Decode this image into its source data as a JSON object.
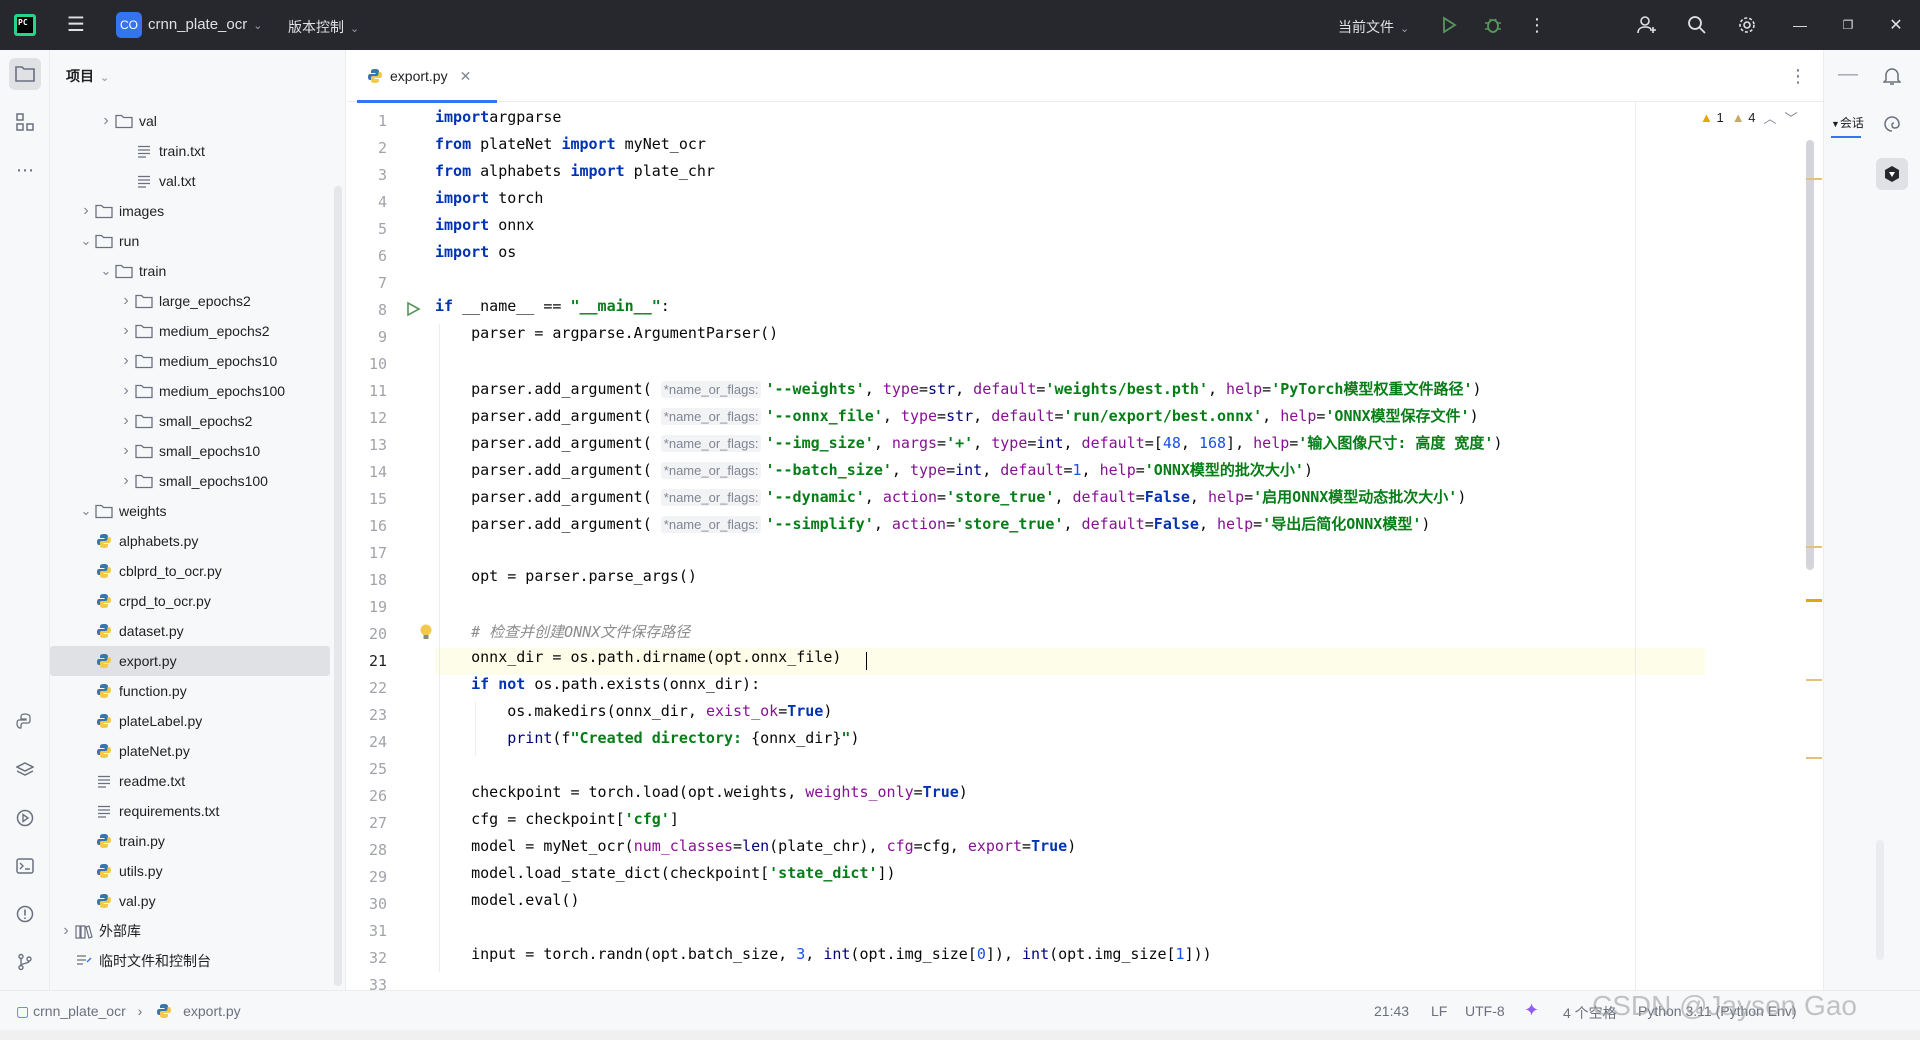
{
  "titlebar": {
    "project_badge": "CO",
    "project_name": "crnn_plate_ocr",
    "vcs_label": "版本控制",
    "run_config": "当前文件"
  },
  "project_panel": {
    "title": "项目",
    "items": [
      {
        "label": "val",
        "type": "folder",
        "depth": 2,
        "state": "collapsed"
      },
      {
        "label": "train.txt",
        "type": "text",
        "depth": 3
      },
      {
        "label": "val.txt",
        "type": "text",
        "depth": 3
      },
      {
        "label": "images",
        "type": "folder",
        "depth": 1,
        "state": "collapsed"
      },
      {
        "label": "run",
        "type": "folder",
        "depth": 1,
        "state": "expanded"
      },
      {
        "label": "train",
        "type": "folder",
        "depth": 2,
        "state": "expanded"
      },
      {
        "label": "large_epochs2",
        "type": "folder",
        "depth": 3,
        "state": "collapsed"
      },
      {
        "label": "medium_epochs2",
        "type": "folder",
        "depth": 3,
        "state": "collapsed"
      },
      {
        "label": "medium_epochs10",
        "type": "folder",
        "depth": 3,
        "state": "collapsed"
      },
      {
        "label": "medium_epochs100",
        "type": "folder",
        "depth": 3,
        "state": "collapsed"
      },
      {
        "label": "small_epochs2",
        "type": "folder",
        "depth": 3,
        "state": "collapsed"
      },
      {
        "label": "small_epochs10",
        "type": "folder",
        "depth": 3,
        "state": "collapsed"
      },
      {
        "label": "small_epochs100",
        "type": "folder",
        "depth": 3,
        "state": "collapsed"
      },
      {
        "label": "weights",
        "type": "folder",
        "depth": 1,
        "state": "expanded"
      },
      {
        "label": "alphabets.py",
        "type": "python",
        "depth": 1
      },
      {
        "label": "cblprd_to_ocr.py",
        "type": "python",
        "depth": 1
      },
      {
        "label": "crpd_to_ocr.py",
        "type": "python",
        "depth": 1
      },
      {
        "label": "dataset.py",
        "type": "python",
        "depth": 1
      },
      {
        "label": "export.py",
        "type": "python",
        "depth": 1,
        "selected": true
      },
      {
        "label": "function.py",
        "type": "python",
        "depth": 1
      },
      {
        "label": "plateLabel.py",
        "type": "python",
        "depth": 1
      },
      {
        "label": "plateNet.py",
        "type": "python",
        "depth": 1
      },
      {
        "label": "readme.txt",
        "type": "text",
        "depth": 1
      },
      {
        "label": "requirements.txt",
        "type": "text",
        "depth": 1
      },
      {
        "label": "train.py",
        "type": "python",
        "depth": 1
      },
      {
        "label": "utils.py",
        "type": "python",
        "depth": 1
      },
      {
        "label": "val.py",
        "type": "python",
        "depth": 1
      },
      {
        "label": "外部库",
        "type": "library",
        "depth": 0,
        "state": "collapsed"
      },
      {
        "label": "临时文件和控制台",
        "type": "scratch",
        "depth": 0
      }
    ]
  },
  "editor": {
    "tab_label": "export.py",
    "inspections": {
      "errors": "1",
      "warnings": "4"
    },
    "caret_line": 21,
    "lines": [
      [
        [
          "kw",
          "import"
        ],
        [
          "",
          "argparse"
        ]
      ],
      [
        [
          "kw",
          "from"
        ],
        [
          "",
          " plateNet "
        ],
        [
          "kw",
          "import"
        ],
        [
          "",
          " myNet_ocr"
        ]
      ],
      [
        [
          "kw",
          "from"
        ],
        [
          "",
          " alphabets "
        ],
        [
          "kw",
          "import"
        ],
        [
          "",
          " plate_chr"
        ]
      ],
      [
        [
          "kw",
          "import"
        ],
        [
          "",
          " torch"
        ]
      ],
      [
        [
          "kw",
          "import"
        ],
        [
          "",
          " onnx"
        ]
      ],
      [
        [
          "kw",
          "import"
        ],
        [
          "",
          " os"
        ]
      ],
      [],
      [
        [
          "kw",
          "if"
        ],
        [
          "",
          " __name__ == "
        ],
        [
          "st",
          "\"__main__\""
        ],
        [
          "",
          ":"
        ]
      ],
      [
        [
          "",
          "    parser = argparse.ArgumentParser()"
        ]
      ],
      [],
      [
        [
          "",
          "    parser.add_argument( "
        ],
        [
          "hint",
          "*name_or_flags:"
        ],
        [
          "st",
          "'--weights'"
        ],
        [
          "",
          ", "
        ],
        [
          "pr",
          "type"
        ],
        [
          "",
          "="
        ],
        [
          "bi",
          "str"
        ],
        [
          "",
          ", "
        ],
        [
          "pr",
          "default"
        ],
        [
          "",
          "="
        ],
        [
          "st",
          "'weights/best.pth'"
        ],
        [
          "",
          ", "
        ],
        [
          "pr",
          "help"
        ],
        [
          "",
          "="
        ],
        [
          "st",
          "'PyTorch模型权重文件路径'"
        ],
        [
          "",
          ")"
        ]
      ],
      [
        [
          "",
          "    parser.add_argument( "
        ],
        [
          "hint",
          "*name_or_flags:"
        ],
        [
          "st",
          "'--onnx_file'"
        ],
        [
          "",
          ", "
        ],
        [
          "pr",
          "type"
        ],
        [
          "",
          "="
        ],
        [
          "bi",
          "str"
        ],
        [
          "",
          ", "
        ],
        [
          "pr",
          "default"
        ],
        [
          "",
          "="
        ],
        [
          "st",
          "'run/export/best.onnx'"
        ],
        [
          "",
          ", "
        ],
        [
          "pr",
          "help"
        ],
        [
          "",
          "="
        ],
        [
          "st",
          "'ONNX模型保存文件'"
        ],
        [
          "",
          ")"
        ]
      ],
      [
        [
          "",
          "    parser.add_argument( "
        ],
        [
          "hint",
          "*name_or_flags:"
        ],
        [
          "st",
          "'--img_size'"
        ],
        [
          "",
          ", "
        ],
        [
          "pr",
          "nargs"
        ],
        [
          "",
          "="
        ],
        [
          "st",
          "'+'"
        ],
        [
          "",
          ", "
        ],
        [
          "pr",
          "type"
        ],
        [
          "",
          "="
        ],
        [
          "bi",
          "int"
        ],
        [
          "",
          ", "
        ],
        [
          "pr",
          "default"
        ],
        [
          "",
          "=["
        ],
        [
          "nu",
          "48"
        ],
        [
          "",
          ", "
        ],
        [
          "nu",
          "168"
        ],
        [
          "",
          "], "
        ],
        [
          "pr",
          "help"
        ],
        [
          "",
          "="
        ],
        [
          "st",
          "'输入图像尺寸: 高度 宽度'"
        ],
        [
          "",
          ")"
        ]
      ],
      [
        [
          "",
          "    parser.add_argument( "
        ],
        [
          "hint",
          "*name_or_flags:"
        ],
        [
          "st",
          "'--batch_size'"
        ],
        [
          "",
          ", "
        ],
        [
          "pr",
          "type"
        ],
        [
          "",
          "="
        ],
        [
          "bi",
          "int"
        ],
        [
          "",
          ", "
        ],
        [
          "pr",
          "default"
        ],
        [
          "",
          "="
        ],
        [
          "nu",
          "1"
        ],
        [
          "",
          ", "
        ],
        [
          "pr",
          "help"
        ],
        [
          "",
          "="
        ],
        [
          "st",
          "'ONNX模型的批次大小'"
        ],
        [
          "",
          ")"
        ]
      ],
      [
        [
          "",
          "    parser.add_argument( "
        ],
        [
          "hint",
          "*name_or_flags:"
        ],
        [
          "st",
          "'--dynamic'"
        ],
        [
          "",
          ", "
        ],
        [
          "pr",
          "action"
        ],
        [
          "",
          "="
        ],
        [
          "st",
          "'store_true'"
        ],
        [
          "",
          ", "
        ],
        [
          "pr",
          "default"
        ],
        [
          "",
          "="
        ],
        [
          "kw",
          "False"
        ],
        [
          "",
          ", "
        ],
        [
          "pr",
          "help"
        ],
        [
          "",
          "="
        ],
        [
          "st",
          "'启用ONNX模型动态批次大小'"
        ],
        [
          "",
          ")"
        ]
      ],
      [
        [
          "",
          "    parser.add_argument( "
        ],
        [
          "hint",
          "*name_or_flags:"
        ],
        [
          "st",
          "'--simplify'"
        ],
        [
          "",
          ", "
        ],
        [
          "pr",
          "action"
        ],
        [
          "",
          "="
        ],
        [
          "st",
          "'store_true'"
        ],
        [
          "",
          ", "
        ],
        [
          "pr",
          "default"
        ],
        [
          "",
          "="
        ],
        [
          "kw",
          "False"
        ],
        [
          "",
          ", "
        ],
        [
          "pr",
          "help"
        ],
        [
          "",
          "="
        ],
        [
          "st",
          "'导出后简化ONNX模型'"
        ],
        [
          "",
          ")"
        ]
      ],
      [],
      [
        [
          "",
          "    opt = parser.parse_args()"
        ]
      ],
      [],
      [
        [
          "",
          "    "
        ],
        [
          "cm",
          "# 检查并创建ONNX文件保存路径"
        ]
      ],
      [
        [
          "",
          "    onnx_dir = os.path.dirname(opt.onnx_file)"
        ]
      ],
      [
        [
          "",
          "    "
        ],
        [
          "kw",
          "if not"
        ],
        [
          "",
          " os.path.exists(onnx_dir):"
        ]
      ],
      [
        [
          "",
          "        os.makedirs(onnx_dir, "
        ],
        [
          "pr",
          "exist_ok"
        ],
        [
          "",
          "="
        ],
        [
          "kw",
          "True"
        ],
        [
          "",
          ")"
        ]
      ],
      [
        [
          "",
          "        "
        ],
        [
          "bi",
          "print"
        ],
        [
          "",
          "(f"
        ],
        [
          "st",
          "\"Created directory: "
        ],
        [
          "",
          "{onnx_dir}"
        ],
        [
          "st",
          "\""
        ],
        [
          "",
          ")"
        ]
      ],
      [],
      [
        [
          "",
          "    checkpoint = torch.load(opt.weights, "
        ],
        [
          "pr",
          "weights_only"
        ],
        [
          "",
          "="
        ],
        [
          "kw",
          "True"
        ],
        [
          "",
          ")"
        ]
      ],
      [
        [
          "",
          "    cfg = checkpoint["
        ],
        [
          "st",
          "'cfg'"
        ],
        [
          "",
          "]"
        ]
      ],
      [
        [
          "",
          "    model = myNet_ocr("
        ],
        [
          "pr",
          "num_classes"
        ],
        [
          "",
          "="
        ],
        [
          "bi",
          "len"
        ],
        [
          "",
          "(plate_chr), "
        ],
        [
          "pr",
          "cfg"
        ],
        [
          "",
          "=cfg, "
        ],
        [
          "pr",
          "export"
        ],
        [
          "",
          "="
        ],
        [
          "kw",
          "True"
        ],
        [
          "",
          ")"
        ]
      ],
      [
        [
          "",
          "    model.load_state_dict(checkpoint["
        ],
        [
          "st",
          "'state_dict'"
        ],
        [
          "",
          "])"
        ]
      ],
      [
        [
          "",
          "    model.eval()"
        ]
      ],
      [],
      [
        [
          "",
          "    input = torch.randn(opt.batch_size, "
        ],
        [
          "nu",
          "3"
        ],
        [
          "",
          ", "
        ],
        [
          "bi",
          "int"
        ],
        [
          "",
          "(opt.img_size["
        ],
        [
          "nu",
          "0"
        ],
        [
          "",
          "]), "
        ],
        [
          "bi",
          "int"
        ],
        [
          "",
          "(opt.img_size["
        ],
        [
          "nu",
          "1"
        ],
        [
          "",
          "]))"
        ]
      ],
      []
    ]
  },
  "right_strip": {
    "conversation_label": "会话"
  },
  "statusbar": {
    "breadcrumb_project": "crnn_plate_ocr",
    "breadcrumb_file": "export.py",
    "caret_pos": "21:43",
    "line_sep": "LF",
    "encoding": "UTF-8",
    "indent": "4 个空格",
    "interpreter": "Python 3.11 (Python Env)"
  },
  "watermark": "CSDN @Jayson Gao"
}
